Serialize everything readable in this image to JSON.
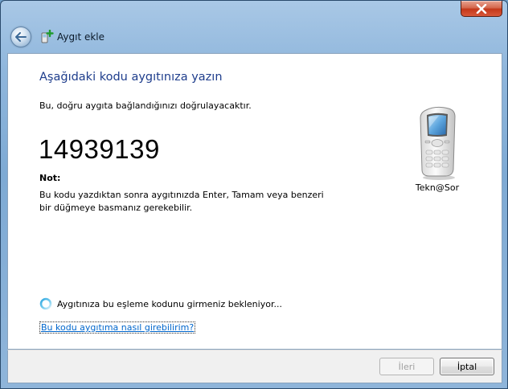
{
  "window": {
    "title": "Aygıt ekle",
    "close_icon": "close-icon",
    "back_icon": "back-arrow-icon",
    "title_icon": "add-device-icon"
  },
  "content": {
    "heading": "Aşağıdaki kodu aygıtınıza yazın",
    "subtitle": "Bu, doğru aygıta bağlandığınızı doğrulayacaktır.",
    "pin_code": "14939139",
    "note_label": "Not:",
    "note_body": "Bu kodu yazdıktan sonra aygıtınızda Enter, Tamam veya benzeri bir düğmeye basmanız gerekebilir.",
    "device": {
      "name": "Tekn@Sor",
      "icon": "mobile-phone-icon"
    },
    "status": {
      "text": "Aygıtınıza bu eşleme kodunu girmeniz bekleniyor...",
      "icon": "busy-spinner-icon"
    },
    "help_link": "Bu kodu aygıtıma nasıl girebilirim?"
  },
  "footer": {
    "next_label": "İleri",
    "cancel_label": "İptal"
  },
  "colors": {
    "heading": "#1e3d8c",
    "link": "#0066cc",
    "close_button": "#c4381a"
  }
}
